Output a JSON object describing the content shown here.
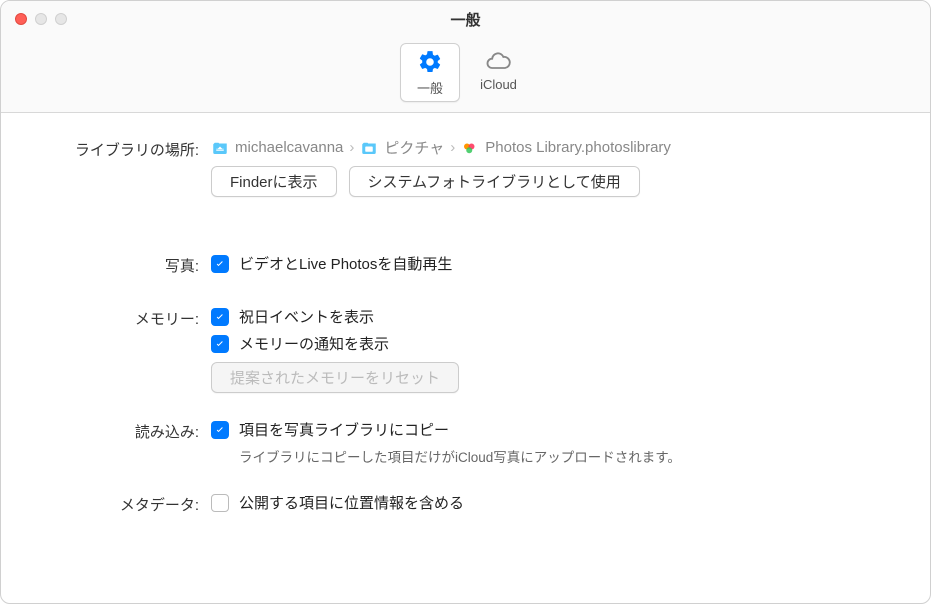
{
  "window": {
    "title": "一般"
  },
  "tabs": {
    "general": "一般",
    "icloud": "iCloud"
  },
  "library": {
    "label": "ライブラリの場所:",
    "path": {
      "seg1": "michaelcavanna",
      "seg2": "ピクチャ",
      "seg3": "Photos Library.photoslibrary"
    },
    "show_in_finder": "Finderに表示",
    "use_as_system": "システムフォトライブラリとして使用"
  },
  "photos": {
    "label": "写真:",
    "autoplay": "ビデオとLive Photosを自動再生"
  },
  "memories": {
    "label": "メモリー:",
    "show_holidays": "祝日イベントを表示",
    "show_notifications": "メモリーの通知を表示",
    "reset_button": "提案されたメモリーをリセット"
  },
  "importing": {
    "label": "読み込み:",
    "copy_items": "項目を写真ライブラリにコピー",
    "helper": "ライブラリにコピーした項目だけがiCloud写真にアップロードされます。"
  },
  "metadata": {
    "label": "メタデータ:",
    "include_location": "公開する項目に位置情報を含める"
  }
}
